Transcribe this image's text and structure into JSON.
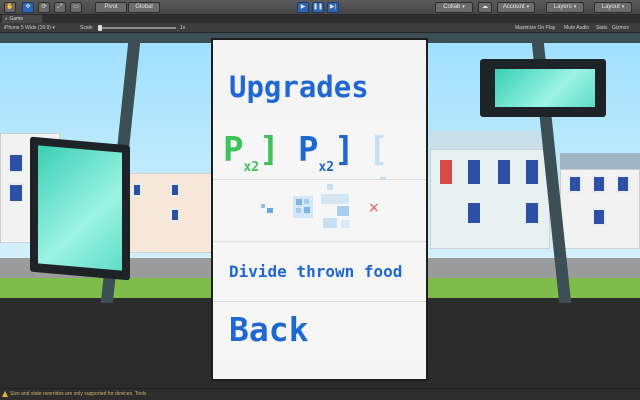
{
  "toolbar": {
    "pivot_label": "Pivot",
    "global_label": "Global",
    "collab_label": "Collab",
    "account_label": "Account",
    "layers_label": "Layers",
    "layout_label": "Layout",
    "tools": [
      "hand-tool-icon",
      "move-tool-icon",
      "rotate-tool-icon",
      "scale-tool-icon",
      "rect-tool-icon"
    ],
    "play_icons": [
      "play-icon",
      "pause-icon",
      "step-icon"
    ]
  },
  "game_tab": {
    "label": "Game"
  },
  "game_options": {
    "device": "iPhone 5 Wide (16:9)",
    "scale_label": "Scale",
    "scale_value": "1x",
    "maximize": "Maximize On Play",
    "mute": "Mute Audio",
    "stats": "Stats",
    "gizmos": "Gizmos"
  },
  "upgrades_menu": {
    "title": "Upgrades",
    "powerups": [
      {
        "letter": "P",
        "sub": "x2",
        "bracket": "]",
        "style": "green"
      },
      {
        "letter": "P",
        "sub": "x2",
        "bracket": "]",
        "style": "blue"
      },
      {
        "letter": "[",
        "sub": "",
        "bracket": "",
        "style": "pale"
      }
    ],
    "divide_label": "Divide thrown food",
    "back_label": "Back",
    "close_glyph": "×"
  },
  "status_bar": {
    "message": "Size and state overrides are only supported for devices. Tools"
  },
  "colors": {
    "accent_blue": "#1f67d3",
    "accent_green": "#3ec25a",
    "unity_play_blue": "#2f64b0"
  }
}
